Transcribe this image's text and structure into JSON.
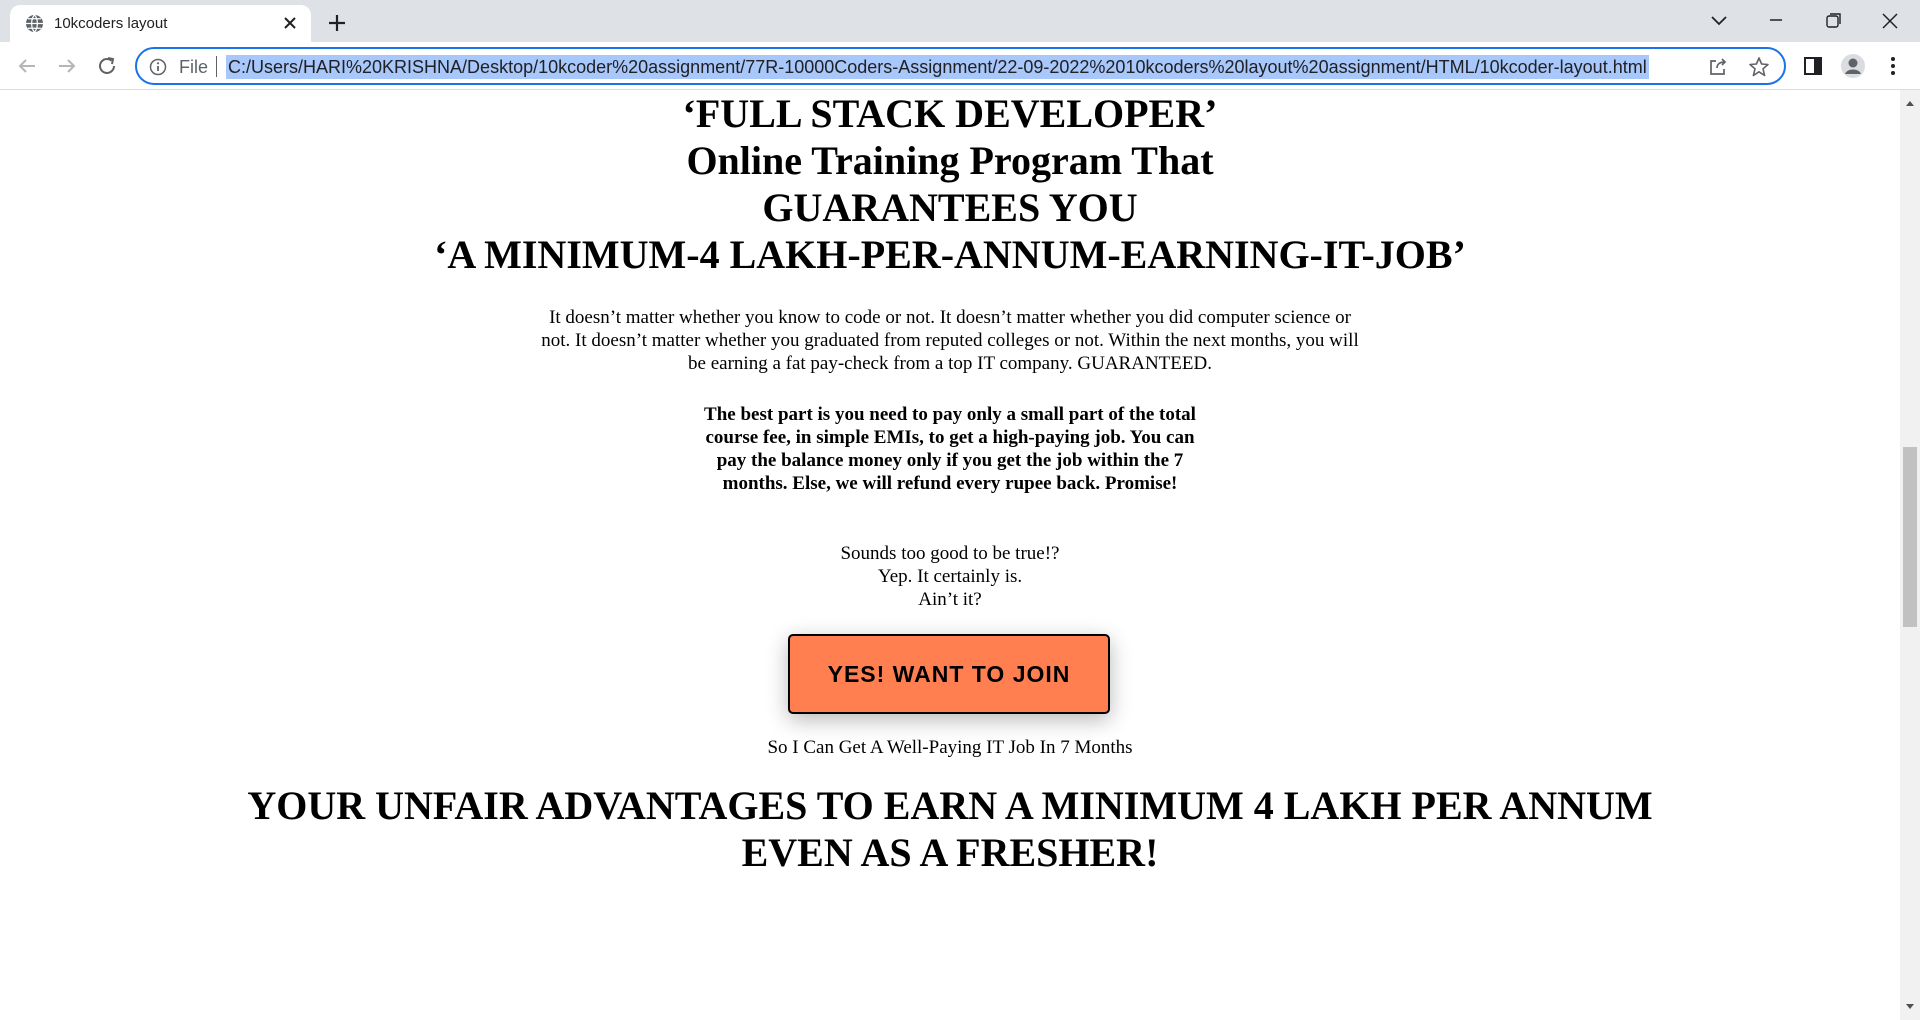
{
  "browser": {
    "tab_title": "10kcoders layout",
    "scheme_label": "File",
    "url": "C:/Users/HARI%20KRISHNA/Desktop/10kcoder%20assignment/77R-10000Coders-Assignment/22-09-2022%2010kcoders%20layout%20assignment/HTML/10kcoder-layout.html",
    "accent_color": "#1a73e8",
    "icons": [
      "globe-icon",
      "close-icon",
      "plus-icon",
      "chevron-down-icon",
      "minimize-icon",
      "restore-icon",
      "close-window-icon",
      "back-arrow-icon",
      "forward-arrow-icon",
      "reload-icon",
      "info-icon",
      "share-icon",
      "star-icon",
      "side-panel-icon",
      "profile-icon",
      "more-icon"
    ]
  },
  "page": {
    "heading_lines": [
      "‘FULL STACK DEVELOPER’",
      "Online Training Program That",
      "GUARANTEES YOU",
      "‘A MINIMUM-4 LAKH-PER-ANNUM-EARNING-IT-JOB’"
    ],
    "intro": "It doesn’t matter whether you know to code or not. It doesn’t matter whether you did computer science or not. It doesn’t matter whether you graduated from reputed colleges or not. Within the next months, you will be earning a fat pay-check from a top IT company. GUARANTEED.",
    "promise": "The best part is you need to pay only a small part of the total course fee, in simple EMIs, to get a high-paying job. You can pay the balance money only if you get the job within the 7 months. Else, we will refund every rupee back. Promise!",
    "tease_lines": [
      "Sounds too good to be true!?",
      "Yep. It certainly is.",
      "Ain’t it?"
    ],
    "join_button": "YES! WANT TO JOIN",
    "join_button_color": "#ff7f50",
    "join_subtext": "So I Can Get A Well-Paying IT Job In 7 Months",
    "advantages_lines": [
      "YOUR UNFAIR ADVANTAGES TO EARN A MINIMUM 4 LAKH PER ANNUM",
      "EVEN AS A FRESHER!"
    ]
  }
}
